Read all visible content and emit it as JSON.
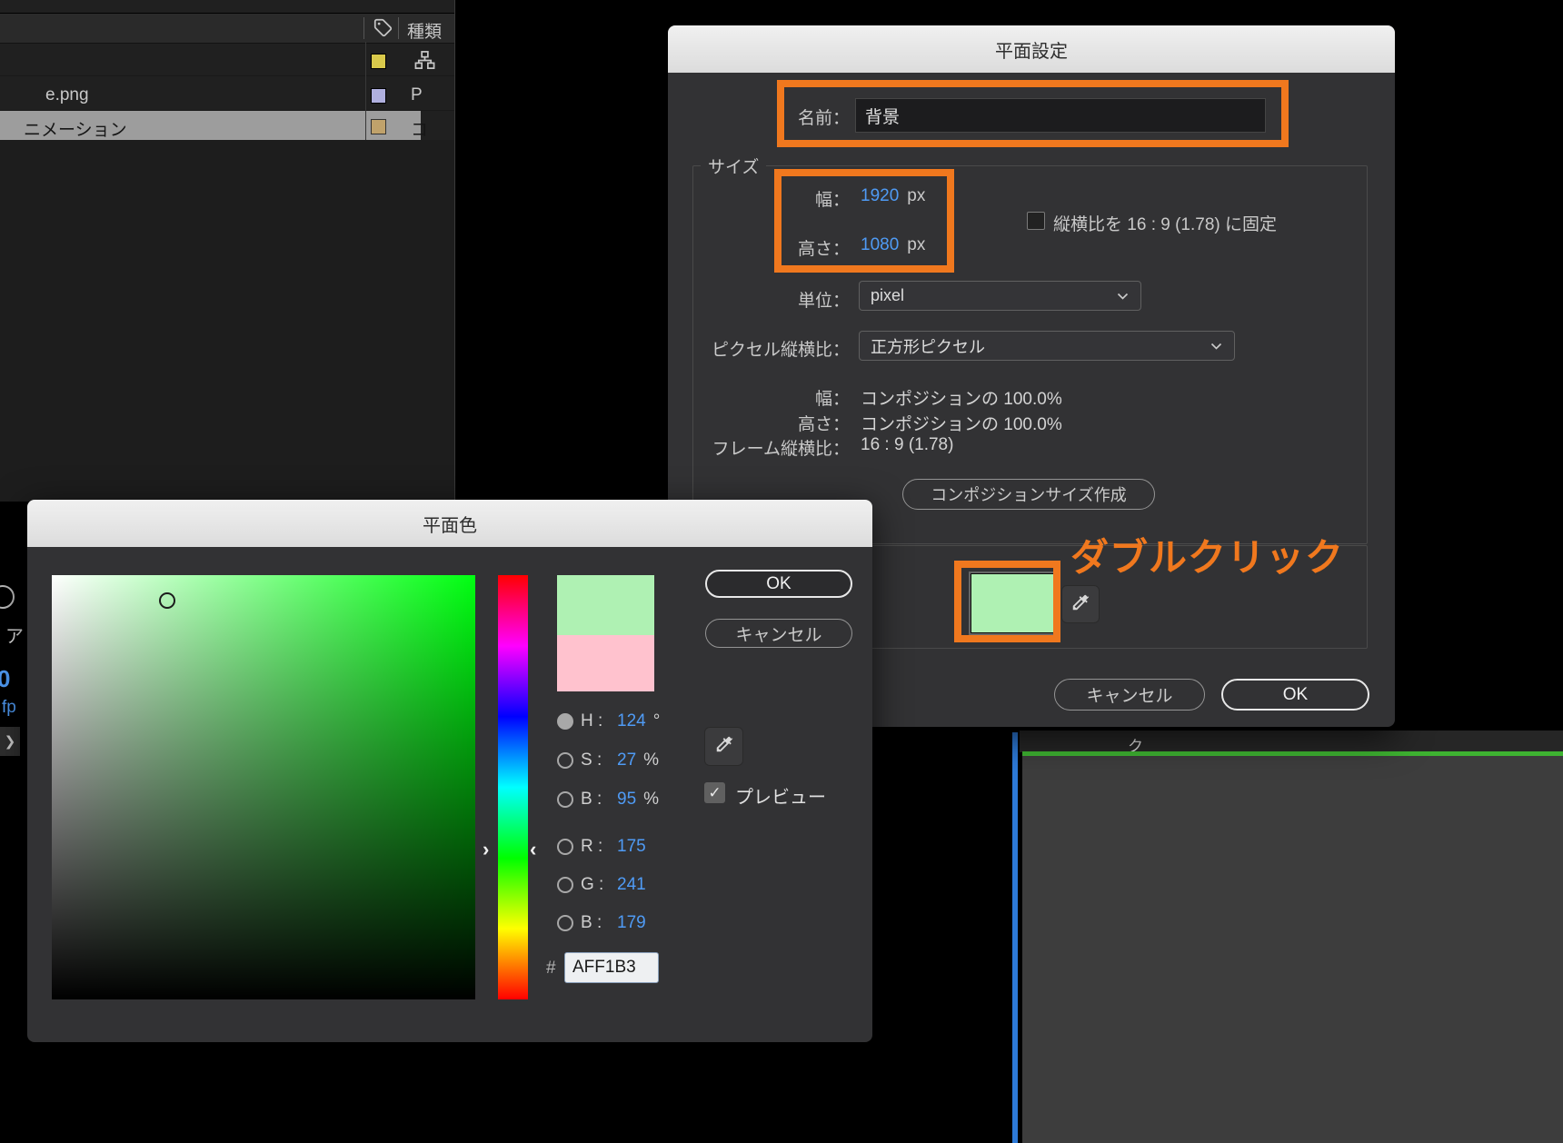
{
  "colors": {
    "orange": "#F0781E",
    "value_blue": "#4F9BF5",
    "new_color": "#AFF1B3",
    "previous_color": "#FFC2CE",
    "timeline_green": "#3EB331",
    "cti_blue": "#2D7AD8"
  },
  "icons": {
    "chevron_right": "❯",
    "check": "✓",
    "hue_arrow_left": "›",
    "hue_arrow_right": "‹"
  },
  "project_panel": {
    "type_header": "種類",
    "rows": [
      {
        "name": "",
        "type": ""
      },
      {
        "name": "e.png",
        "type": "P"
      },
      {
        "name": "ニメーション",
        "type": "コ"
      }
    ],
    "swatches": [
      "#D9C94B",
      "#AFAFDE",
      "#C0A26B"
    ]
  },
  "left_strip": {
    "char_a": "ア",
    "num": "0",
    "fps": "fp"
  },
  "timeline": {
    "header_char": "ク"
  },
  "solid_settings": {
    "title": "平面設定",
    "name_label": "名前：",
    "name_value": "背景",
    "size_group_label": "サイズ",
    "width_label": "幅：",
    "width_value": "1920",
    "width_unit": "px",
    "height_label": "高さ：",
    "height_value": "1080",
    "height_unit": "px",
    "aspect_checkbox_label": "縦横比を 16 : 9 (1.78) に固定",
    "units_label": "単位：",
    "units_value": "pixel",
    "par_label": "ピクセル縦横比：",
    "par_value": "正方形ピクセル",
    "info_width_label": "幅：",
    "info_width_value": "コンポジションの 100.0%",
    "info_height_label": "高さ：",
    "info_height_value": "コンポジションの 100.0%",
    "info_frame_label": "フレーム縦横比：",
    "info_frame_value": "16 : 9 (1.78)",
    "make_comp_size_button": "コンポジションサイズ作成",
    "cancel_button": "キャンセル",
    "ok_button": "OK"
  },
  "annotation": {
    "double_click": "ダブルクリック"
  },
  "color_picker": {
    "title": "平面色",
    "ok_button": "OK",
    "cancel_button": "キャンセル",
    "preview_label": "プレビュー",
    "h": {
      "label": "H :",
      "value": "124",
      "unit": "°"
    },
    "s": {
      "label": "S :",
      "value": "27",
      "unit": "%"
    },
    "b": {
      "label": "B :",
      "value": "95",
      "unit": "%"
    },
    "r": {
      "label": "R :",
      "value": "175"
    },
    "g": {
      "label": "G :",
      "value": "241"
    },
    "b2": {
      "label": "B :",
      "value": "179"
    },
    "hex_prefix": "#",
    "hex_value": "AFF1B3"
  }
}
